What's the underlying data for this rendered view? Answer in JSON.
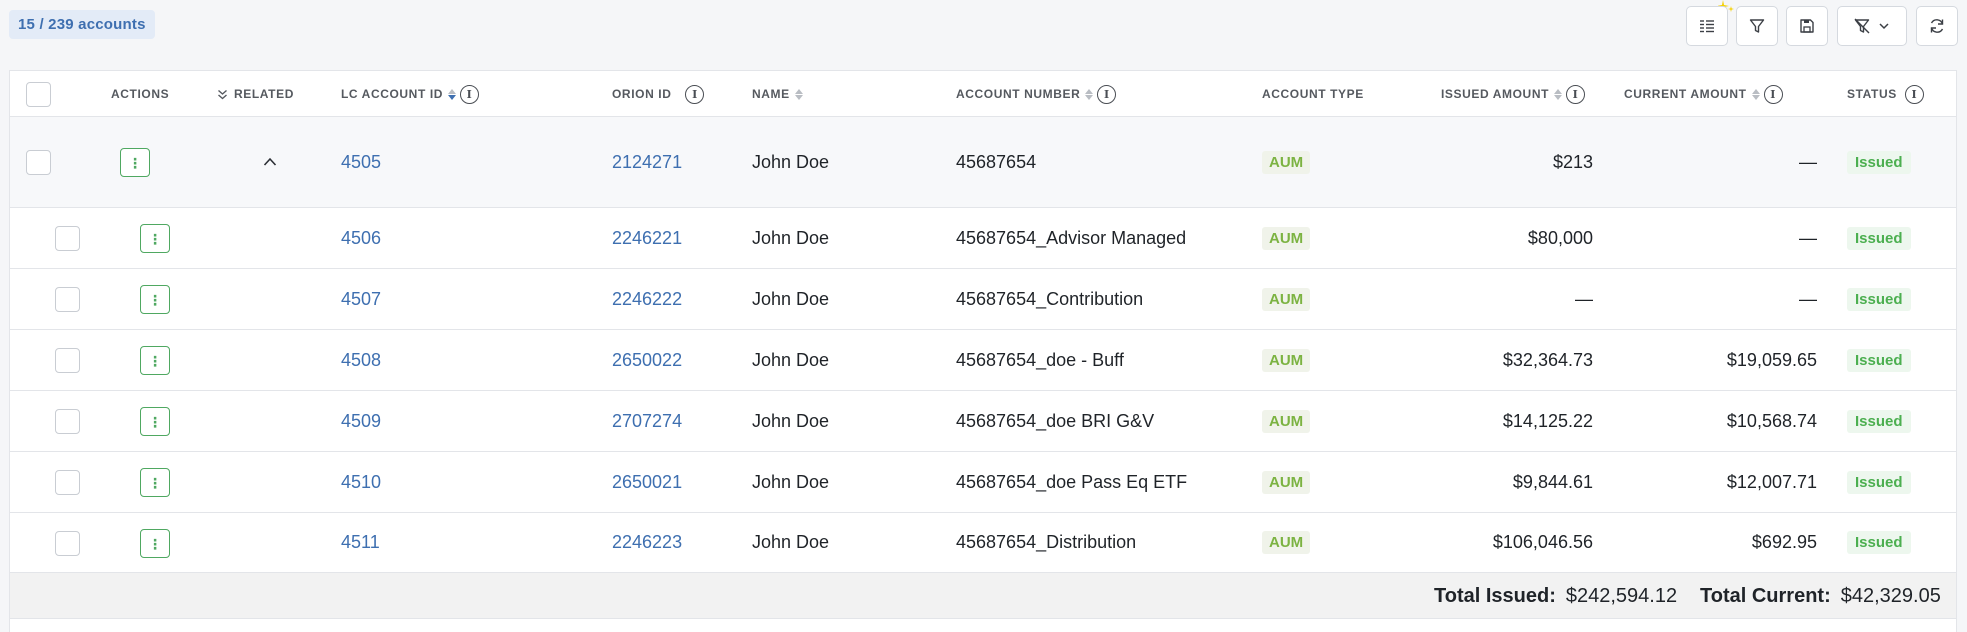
{
  "header": {
    "count_label": "15 / 239 accounts"
  },
  "table": {
    "columns": {
      "actions": "ACTIONS",
      "related": "RELATED",
      "lc_account_id": "LC ACCOUNT ID",
      "orion_id": "ORION ID",
      "name": "NAME",
      "account_number": "ACCOUNT NUMBER",
      "account_type": "ACCOUNT TYPE",
      "issued_amount": "ISSUED AMOUNT",
      "current_amount": "CURRENT AMOUNT",
      "status": "STATUS"
    },
    "rows": [
      {
        "lc_id": "4505",
        "orion_id": "2124271",
        "name": "John Doe",
        "account_number": "45687654",
        "type": "AUM",
        "issued": "$213",
        "current": "—",
        "status": "Issued"
      },
      {
        "lc_id": "4506",
        "orion_id": "2246221",
        "name": "John Doe",
        "account_number": "45687654_Advisor Managed",
        "type": "AUM",
        "issued": "$80,000",
        "current": "—",
        "status": "Issued"
      },
      {
        "lc_id": "4507",
        "orion_id": "2246222",
        "name": "John Doe",
        "account_number": "45687654_Contribution",
        "type": "AUM",
        "issued": "—",
        "current": "—",
        "status": "Issued"
      },
      {
        "lc_id": "4508",
        "orion_id": "2650022",
        "name": "John Doe",
        "account_number": "45687654_doe - Buff",
        "type": "AUM",
        "issued": "$32,364.73",
        "current": "$19,059.65",
        "status": "Issued"
      },
      {
        "lc_id": "4509",
        "orion_id": "2707274",
        "name": "John Doe",
        "account_number": "45687654_doe BRI G&V",
        "type": "AUM",
        "issued": "$14,125.22",
        "current": "$10,568.74",
        "status": "Issued"
      },
      {
        "lc_id": "4510",
        "orion_id": "2650021",
        "name": "John Doe",
        "account_number": "45687654_doe Pass Eq ETF",
        "type": "AUM",
        "issued": "$9,844.61",
        "current": "$12,007.71",
        "status": "Issued"
      },
      {
        "lc_id": "4511",
        "orion_id": "2246223",
        "name": "John Doe",
        "account_number": "45687654_Distribution",
        "type": "AUM",
        "issued": "$106,046.56",
        "current": "$692.95",
        "status": "Issued"
      }
    ],
    "action_glyph": "⋮",
    "info_glyph": "i"
  },
  "footer": {
    "total_issued_label": "Total Issued:",
    "total_issued_value": "$242,594.12",
    "total_current_label": "Total Current:",
    "total_current_value": "$42,329.05"
  },
  "icons": {
    "toolbar": [
      "columns-icon",
      "filter-icon",
      "save-icon",
      "clear-filter-icon",
      "refresh-icon"
    ],
    "sparkle_color": "#f5d000"
  }
}
